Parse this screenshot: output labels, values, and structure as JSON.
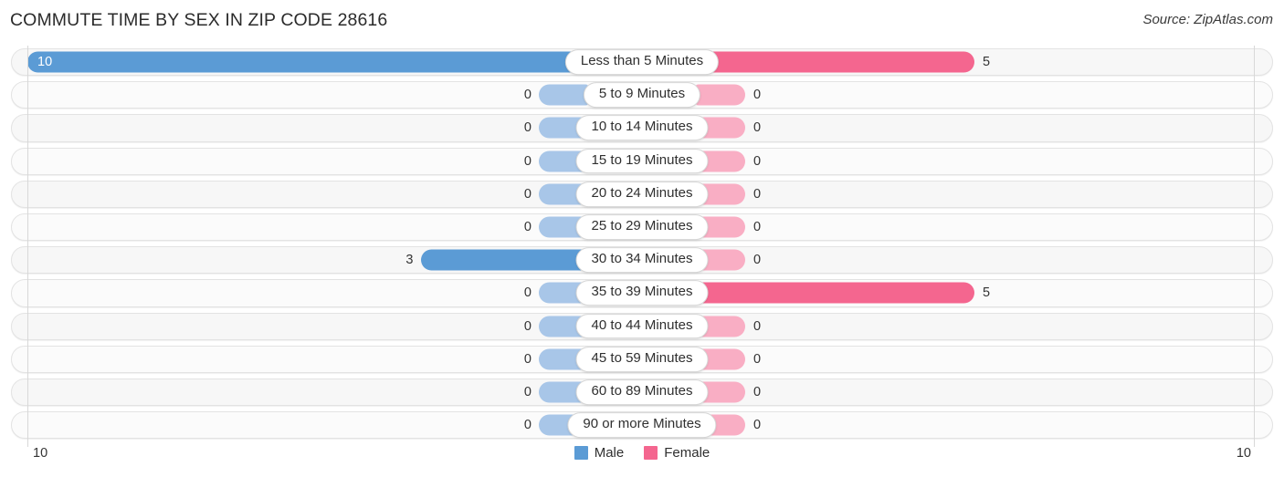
{
  "header": {
    "title": "COMMUTE TIME BY SEX IN ZIP CODE 28616",
    "source": "Source: ZipAtlas.com"
  },
  "legend": {
    "male_label": "Male",
    "female_label": "Female",
    "male_color": "#5b9bd5",
    "female_color": "#f4668f"
  },
  "axis": {
    "left_tick": "10",
    "right_tick": "10"
  },
  "colors": {
    "male": "#5b9bd5",
    "male_zero": "#a8c6e8",
    "female": "#f4668f",
    "female_zero": "#f9aec4",
    "track": "#f7f7f7",
    "gridline": "#d8d8d8"
  },
  "chart_data": {
    "type": "bar",
    "subtype": "diverging-bidirectional",
    "title": "COMMUTE TIME BY SEX IN ZIP CODE 28616",
    "xlabel": "",
    "ylabel": "",
    "xlim": [
      10,
      10
    ],
    "grid": true,
    "legend_position": "bottom-center",
    "categories": [
      "Less than 5 Minutes",
      "5 to 9 Minutes",
      "10 to 14 Minutes",
      "15 to 19 Minutes",
      "20 to 24 Minutes",
      "25 to 29 Minutes",
      "30 to 34 Minutes",
      "35 to 39 Minutes",
      "40 to 44 Minutes",
      "45 to 59 Minutes",
      "60 to 89 Minutes",
      "90 or more Minutes"
    ],
    "series": [
      {
        "name": "Male",
        "direction": "left",
        "color": "#5b9bd5",
        "values": [
          10,
          0,
          0,
          0,
          0,
          0,
          3,
          0,
          0,
          0,
          0,
          0
        ]
      },
      {
        "name": "Female",
        "direction": "right",
        "color": "#f4668f",
        "values": [
          5,
          0,
          0,
          0,
          0,
          0,
          0,
          5,
          0,
          0,
          0,
          0
        ]
      }
    ]
  },
  "rows": [
    {
      "label": "Less than 5 Minutes",
      "male": "10",
      "female": "5",
      "male_val": 10,
      "female_val": 5
    },
    {
      "label": "5 to 9 Minutes",
      "male": "0",
      "female": "0",
      "male_val": 0,
      "female_val": 0
    },
    {
      "label": "10 to 14 Minutes",
      "male": "0",
      "female": "0",
      "male_val": 0,
      "female_val": 0
    },
    {
      "label": "15 to 19 Minutes",
      "male": "0",
      "female": "0",
      "male_val": 0,
      "female_val": 0
    },
    {
      "label": "20 to 24 Minutes",
      "male": "0",
      "female": "0",
      "male_val": 0,
      "female_val": 0
    },
    {
      "label": "25 to 29 Minutes",
      "male": "0",
      "female": "0",
      "male_val": 0,
      "female_val": 0
    },
    {
      "label": "30 to 34 Minutes",
      "male": "3",
      "female": "0",
      "male_val": 3,
      "female_val": 0
    },
    {
      "label": "35 to 39 Minutes",
      "male": "0",
      "female": "5",
      "male_val": 0,
      "female_val": 5
    },
    {
      "label": "40 to 44 Minutes",
      "male": "0",
      "female": "0",
      "male_val": 0,
      "female_val": 0
    },
    {
      "label": "45 to 59 Minutes",
      "male": "0",
      "female": "0",
      "male_val": 0,
      "female_val": 0
    },
    {
      "label": "60 to 89 Minutes",
      "male": "0",
      "female": "0",
      "male_val": 0,
      "female_val": 0
    },
    {
      "label": "90 or more Minutes",
      "male": "0",
      "female": "0",
      "male_val": 0,
      "female_val": 0
    }
  ]
}
